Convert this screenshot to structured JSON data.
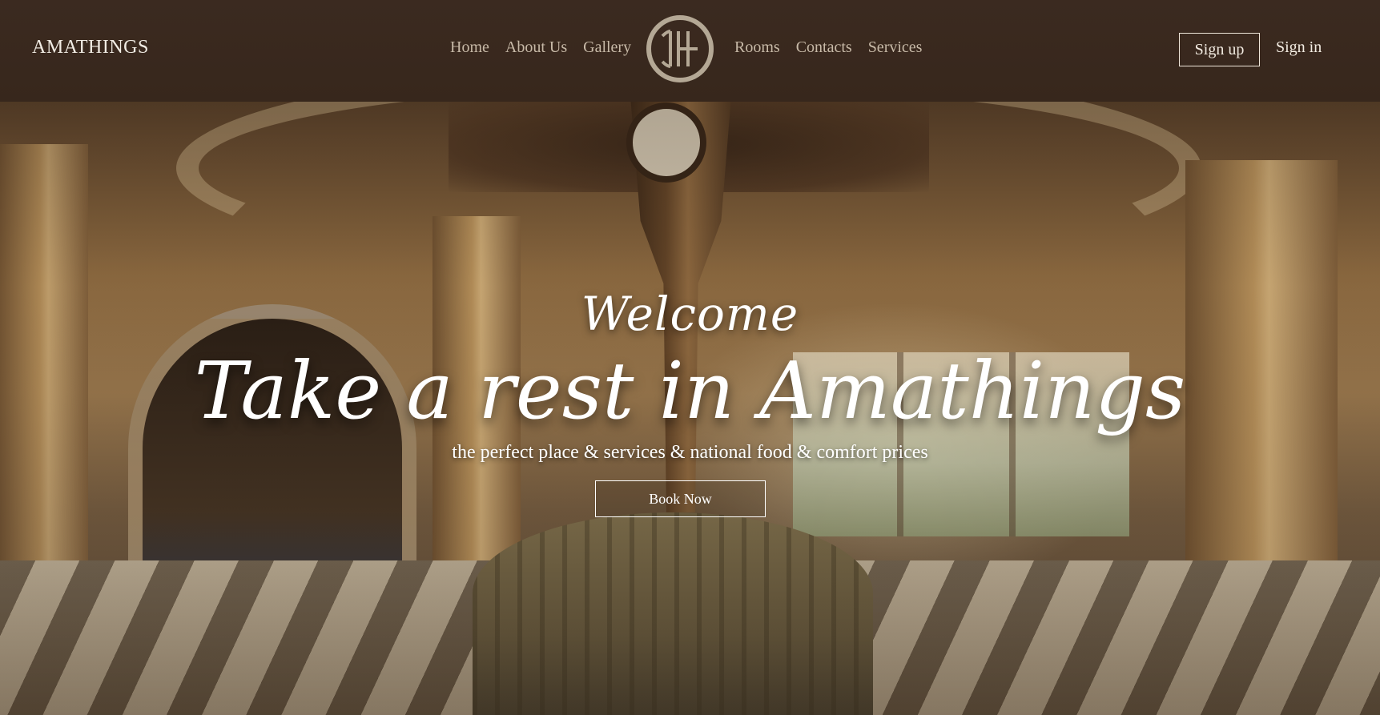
{
  "header": {
    "brand": "AMATHINGS",
    "nav_left": [
      "Home",
      "About Us",
      "Gallery"
    ],
    "nav_right": [
      "Rooms",
      "Contacts",
      "Services"
    ],
    "signup_label": "Sign up",
    "signin_label": "Sign in",
    "logo_icon": "monogram-logo"
  },
  "hero": {
    "welcome": "Welcome",
    "headline": "Take a rest in Amathings",
    "tagline": "the perfect place & services & national food & comfort prices",
    "cta_label": "Book Now"
  },
  "colors": {
    "header_bg": "#3a2a1f",
    "nav_text": "#c7b9a7",
    "hero_text": "#ffffff",
    "logo_ring": "#b4a895"
  }
}
